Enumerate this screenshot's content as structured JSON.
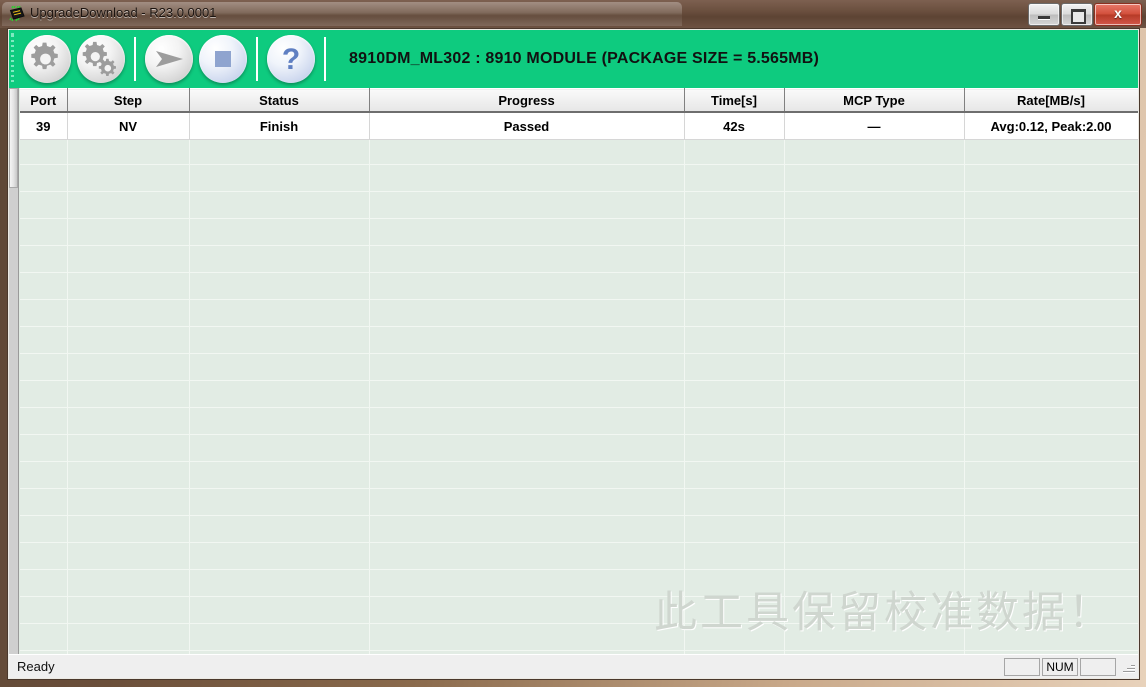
{
  "window": {
    "title": "UpgradeDownload - R23.0.0001",
    "icon": "chip-icon",
    "minimize_label": "",
    "maximize_label": "",
    "close_label": "x"
  },
  "toolbar": {
    "buttons": [
      {
        "name": "settings-button",
        "icon": "gear-icon"
      },
      {
        "name": "options-button",
        "icon": "gears-icon"
      },
      {
        "name": "start-button",
        "icon": "play-arrow-icon"
      },
      {
        "name": "stop-button",
        "icon": "stop-square-icon"
      },
      {
        "name": "help-button",
        "icon": "question-mark-icon",
        "glyph": "?"
      }
    ],
    "title": "8910DM_ML302 : 8910 MODULE (PACKAGE SIZE = 5.565MB)",
    "background_color": "#0ecb7f"
  },
  "grid": {
    "columns": [
      "Port",
      "Step",
      "Status",
      "Progress",
      "Time[s]",
      "MCP Type",
      "Rate[MB/s]"
    ],
    "rows": [
      {
        "port": "39",
        "step": "NV",
        "status": "Finish",
        "progress": "Passed",
        "time": "42s",
        "mcp_type": "—",
        "rate": "Avg:0.12, Peak:2.00"
      }
    ],
    "progress_color": "#12b312",
    "value_color": "#1515dd",
    "empty_row_color": "#e2ece4"
  },
  "watermark": {
    "text": "此工具保留校准数据！",
    "color": "#cfd6cf"
  },
  "statusbar": {
    "message": "Ready",
    "pane_left": "",
    "pane_num": "NUM",
    "pane_right": ""
  }
}
